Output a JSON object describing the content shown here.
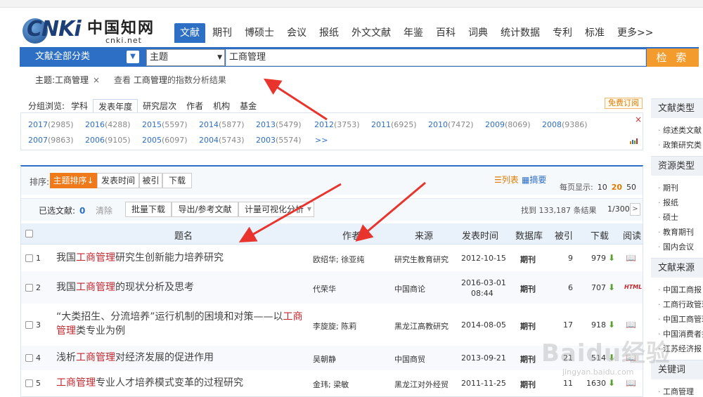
{
  "brand": {
    "cnki": "CNKi",
    "cn_name": "中国知网",
    "domain": "cnki.net"
  },
  "nav": {
    "tabs": [
      "文献",
      "期刊",
      "博硕士",
      "会议",
      "报纸",
      "外文文献",
      "年鉴",
      "百科",
      "词典",
      "统计数据",
      "专利",
      "标准",
      "更多>>"
    ],
    "active": 0
  },
  "search": {
    "category": "文献全部分类",
    "field": "主题",
    "query": "工商管理",
    "button": "检 索"
  },
  "topic_tag": {
    "label": "主题:工商管理",
    "close": "×"
  },
  "index_link": {
    "prefix": "查看",
    "keyword": "工商管理",
    "suffix": "的指数分析结果"
  },
  "group": {
    "label": "分组浏览:",
    "items": [
      "学科",
      "发表年度",
      "研究层次",
      "作者",
      "机构",
      "基金"
    ],
    "active": 1
  },
  "free_sub": "免费订阅",
  "years": [
    {
      "y": "2017",
      "c": "(2985)"
    },
    {
      "y": "2016",
      "c": "(4288)"
    },
    {
      "y": "2015",
      "c": "(5597)"
    },
    {
      "y": "2014",
      "c": "(5877)"
    },
    {
      "y": "2013",
      "c": "(5479)"
    },
    {
      "y": "2012",
      "c": "(3753)"
    },
    {
      "y": "2011",
      "c": "(6925)"
    },
    {
      "y": "2010",
      "c": "(7472)"
    },
    {
      "y": "2009",
      "c": "(8069)"
    },
    {
      "y": "2008",
      "c": "(9386)"
    },
    {
      "y": "2007",
      "c": "(9863)"
    },
    {
      "y": "2006",
      "c": "(9105)"
    },
    {
      "y": "2005",
      "c": "(6097)"
    },
    {
      "y": "2004",
      "c": "(5743)"
    },
    {
      "y": "2003",
      "c": "(5574)"
    }
  ],
  "years_more": ">>",
  "years_close": "×",
  "sort": {
    "label": "排序:",
    "buttons": [
      "主题排序↓",
      "发表时间",
      "被引",
      "下载"
    ]
  },
  "view": {
    "list": "☰列表",
    "abstract": "▦摘要"
  },
  "per_page": {
    "label": "每页显示:",
    "options": [
      "10",
      "20",
      "50"
    ],
    "active": "20"
  },
  "tools": {
    "selected_label": "已选文献:",
    "selected_count": "0",
    "clear": "清除",
    "batch": "批量下载",
    "export": "导出/参考文献",
    "visual": "计量可视化分析"
  },
  "found": "找到 133,187 条结果",
  "page": "1/300",
  "page_next": ">",
  "columns": [
    "题名",
    "作者",
    "来源",
    "发表时间",
    "数据库",
    "被引",
    "下载",
    "阅读"
  ],
  "rows": [
    {
      "n": "1",
      "pre": "我国",
      "hl": "工商管理",
      "post": "研究生创新能力培养研究",
      "line2": "",
      "author": "欧绍华; 徐亚纯",
      "source": "研究生教育研究",
      "date": "2012-10-15",
      "date2": "",
      "db": "期刊",
      "cited": "9",
      "dl": "979"
    },
    {
      "n": "2",
      "pre": "我国",
      "hl": "工商管理",
      "post": "的现状分析及思考",
      "line2": "",
      "author": "代荣华",
      "source": "中国商论",
      "date": "2016-03-01",
      "date2": "08:44",
      "db": "期刊",
      "cited": "6",
      "dl": "707"
    },
    {
      "n": "3",
      "pre": "“大类招生、分流培养”运行机制的困境和对策——以",
      "hl": "工商管理",
      "post": "类专业为例",
      "line2": "yes",
      "author": "李旋旋; 陈莉",
      "source": "黑龙江高教研究",
      "date": "2014-08-05",
      "date2": "",
      "db": "期刊",
      "cited": "17",
      "dl": "918"
    },
    {
      "n": "4",
      "pre": "浅析",
      "hl": "工商管理",
      "post": "对经济发展的促进作用",
      "line2": "",
      "author": "吴朝静",
      "source": "中国商贸",
      "date": "2013-09-21",
      "date2": "",
      "db": "期刊",
      "cited": "21",
      "dl": "514"
    },
    {
      "n": "5",
      "pre": "",
      "hl": "工商管理",
      "post": "专业人才培养模式变革的过程研究",
      "line2": "",
      "author": "金玮; 梁敏",
      "source": "黑龙江对外经贸",
      "date": "2011-11-25",
      "date2": "",
      "db": "期刊",
      "cited": "11",
      "dl": "1630"
    }
  ],
  "sidebar": {
    "sections": [
      {
        "title": "文献类型",
        "items": [
          "综述类文献",
          "政策研究类"
        ]
      },
      {
        "title": "资源类型",
        "items": [
          "期刊",
          "报纸",
          "硕士",
          "教育期刊",
          "国内会议"
        ]
      },
      {
        "title": "文献来源",
        "items": [
          "中国工商报",
          "工商行政管理",
          "中国工商管理",
          "中国消费者报",
          "江苏经济报"
        ]
      },
      {
        "title": "关键词",
        "items": [
          "工商管理"
        ]
      }
    ]
  },
  "watermark": {
    "main": "Baidu经验",
    "sub": "jingyan.baidu.com"
  },
  "colors": {
    "primary": "#2d6fc5",
    "accent": "#f39b2d",
    "highlight": "#c1272d",
    "annotation": "#e8342c"
  }
}
